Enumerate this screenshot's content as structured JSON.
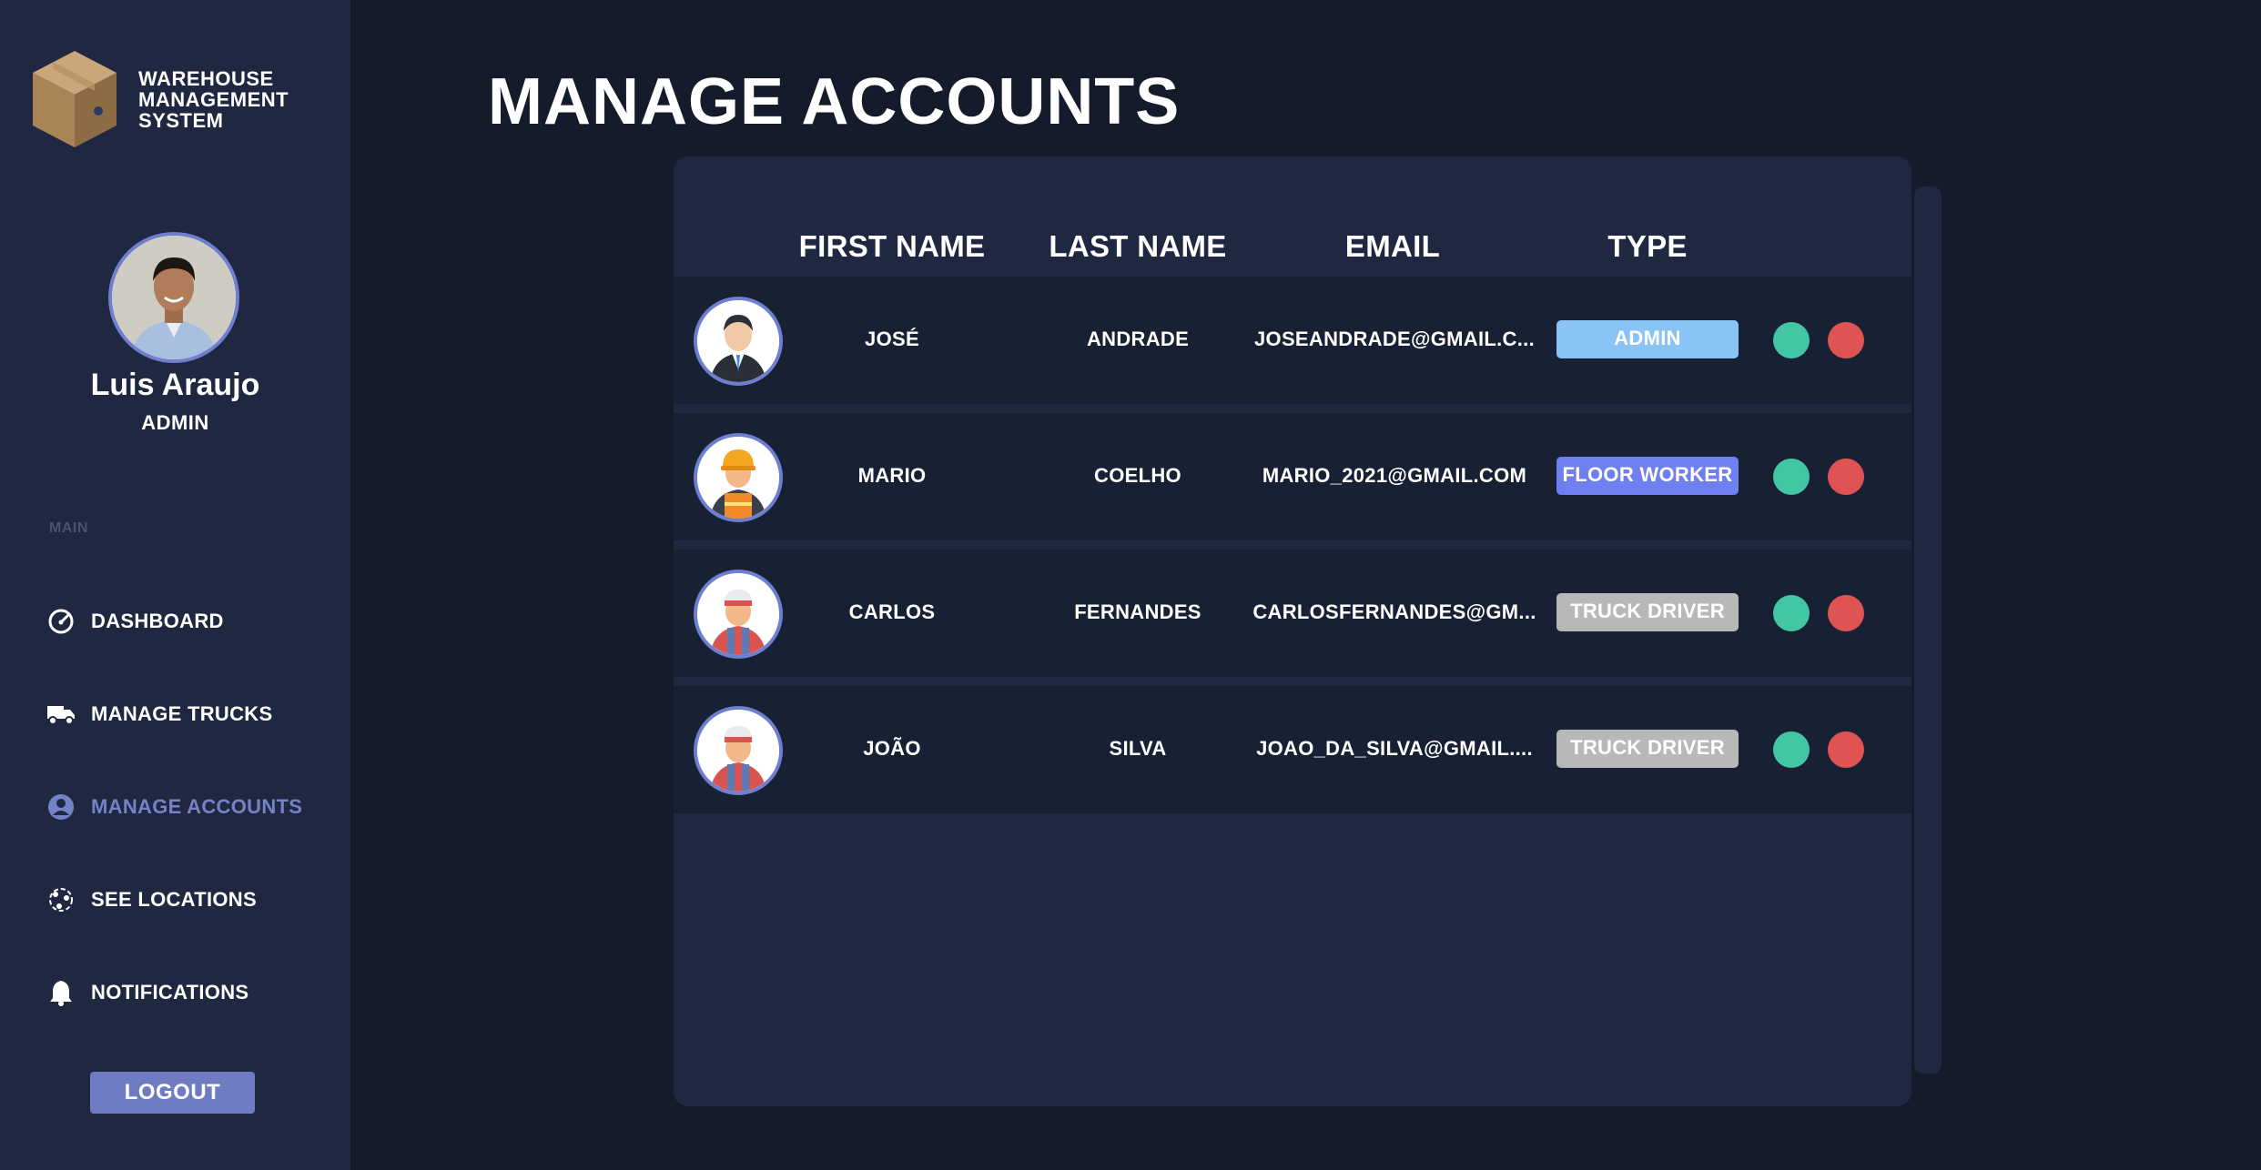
{
  "brand": {
    "lines": [
      "WAREHOUSE",
      "MANAGEMENT",
      "SYSTEM"
    ]
  },
  "profile": {
    "name": "Luis Araujo",
    "role": "ADMIN"
  },
  "sidebar": {
    "section_label": "MAIN",
    "items": [
      {
        "label": "DASHBOARD",
        "icon": "speedometer-icon",
        "active": false
      },
      {
        "label": "MANAGE TRUCKS",
        "icon": "truck-icon",
        "active": false
      },
      {
        "label": "MANAGE ACCOUNTS",
        "icon": "user-circle-icon",
        "active": true
      },
      {
        "label": "SEE LOCATIONS",
        "icon": "map-locations-icon",
        "active": false
      },
      {
        "label": "NOTIFICATIONS",
        "icon": "bell-icon",
        "active": false
      }
    ],
    "logout_label": "LOGOUT"
  },
  "page": {
    "title": "MANAGE ACCOUNTS"
  },
  "table": {
    "headers": {
      "first_name": "FIRST NAME",
      "last_name": "LAST NAME",
      "email": "EMAIL",
      "type": "TYPE"
    },
    "rows": [
      {
        "avatar": "businessman-avatar",
        "first_name": "JOSÉ",
        "last_name": "ANDRADE",
        "email": "JOSEANDRADE@GMAIL.C...",
        "type": "ADMIN",
        "type_color": "#8ac4f7",
        "type_text_color": "#ffffff"
      },
      {
        "avatar": "construction-worker-avatar",
        "first_name": "MARIO",
        "last_name": "COELHO",
        "email": "MARIO_2021@GMAIL.COM",
        "type": "FLOOR WORKER",
        "type_color": "#6f7ff0",
        "type_text_color": "#ffffff"
      },
      {
        "avatar": "truck-driver-avatar",
        "first_name": "CARLOS",
        "last_name": "FERNANDES",
        "email": "CARLOSFERNANDES@GM...",
        "type": "TRUCK DRIVER",
        "type_color": "#b8b8b8",
        "type_text_color": "#ffffff"
      },
      {
        "avatar": "truck-driver-avatar",
        "first_name": "JOÃO",
        "last_name": "SILVA",
        "email": "JOAO_DA_SILVA@GMAIL....",
        "type": "TRUCK DRIVER",
        "type_color": "#b8b8b8",
        "type_text_color": "#ffffff"
      }
    ],
    "action_colors": {
      "edit": "#43c6a4",
      "delete": "#df5452"
    }
  }
}
